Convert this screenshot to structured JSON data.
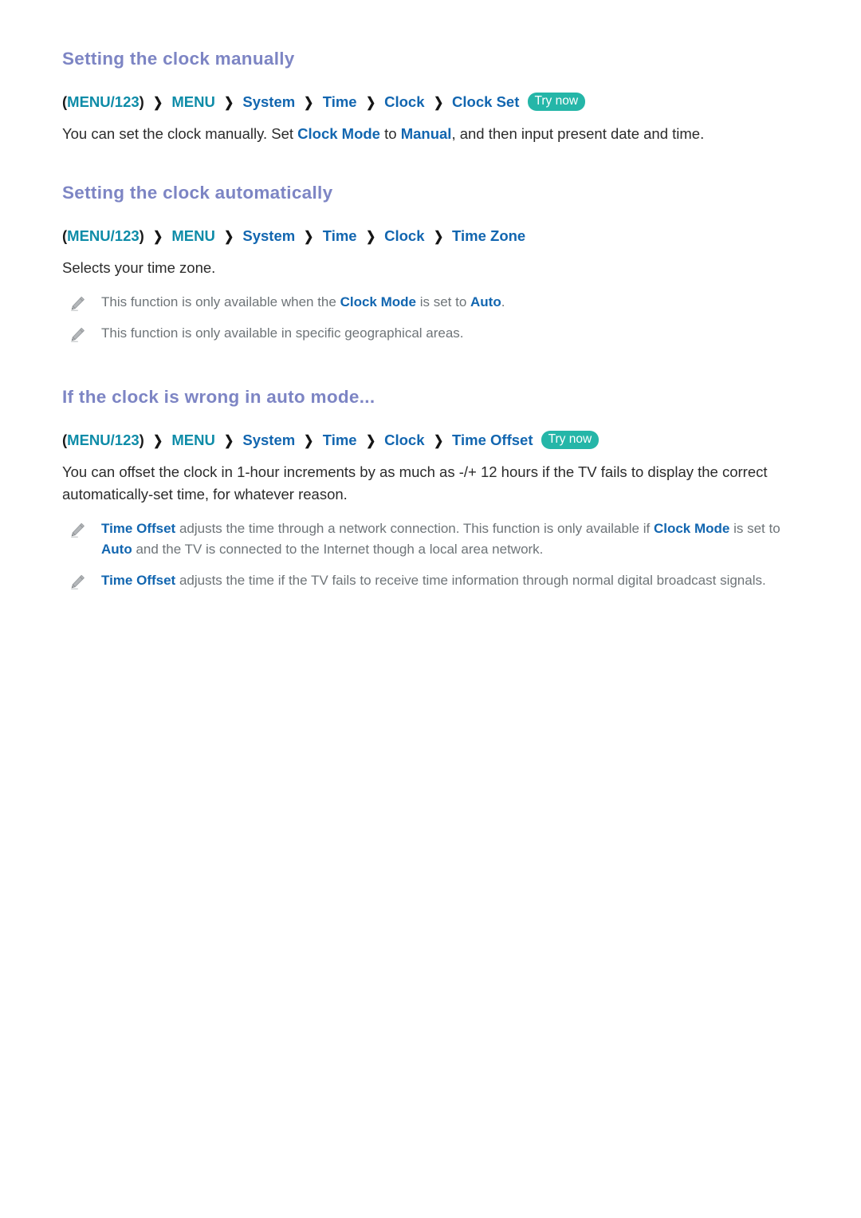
{
  "document": {
    "title": "Setting the clock manually"
  },
  "colors": {
    "heading": "#7d85c4",
    "menu_teal": "#0e8ca8",
    "menu_blue": "#1266b0",
    "try_now_badge": "#25b6a8",
    "body_text": "#2b2b2b",
    "note_text": "#6e7478",
    "background": "#ffffff"
  },
  "chevron": "❯",
  "sections": [
    {
      "heading": "Setting the clock manually",
      "path": {
        "open_paren": "(",
        "menu123": "MENU/123",
        "close_paren": ")",
        "items": [
          "MENU",
          "System",
          "Time",
          "Clock",
          "Clock Set"
        ],
        "badge": "Try now"
      },
      "body": {
        "p1": "You can set the clock manually. Set ",
        "hl1": "Clock Mode",
        "p2": " to ",
        "hl2": "Manual",
        "p3": ", and then input present date and time."
      },
      "notes": []
    },
    {
      "heading": "Setting the clock automatically",
      "path": {
        "open_paren": "(",
        "menu123": "MENU/123",
        "close_paren": ")",
        "items": [
          "MENU",
          "System",
          "Time",
          "Clock",
          "Time Zone"
        ],
        "badge": null
      },
      "body": {
        "p1": "Selects your time zone."
      },
      "notes": [
        {
          "p1": "This function is only available when the ",
          "hl1": "Clock Mode",
          "p2": " is set to ",
          "hl2": "Auto",
          "p3": "."
        },
        {
          "p1": "This function is only available in specific geographical areas."
        }
      ]
    },
    {
      "heading": "If the clock is wrong in auto mode...",
      "path": {
        "open_paren": "(",
        "menu123": "MENU/123",
        "close_paren": ")",
        "items": [
          "MENU",
          "System",
          "Time",
          "Clock",
          "Time Offset"
        ],
        "badge": "Try now"
      },
      "body": {
        "p1": "You can offset the clock in 1-hour increments by as much as -/+ 12 hours if the TV fails to display the correct automatically-set time, for whatever reason."
      },
      "notes": [
        {
          "hl0": "Time Offset",
          "p1": " adjusts the time through a network connection. This function is only available if ",
          "hl1": "Clock Mode",
          "p2": " is set to ",
          "hl2": "Auto",
          "p3": " and the TV is connected to the Internet though a local area network."
        },
        {
          "hl0": "Time Offset",
          "p1": " adjusts the time if the TV fails to receive time information through normal digital broadcast signals."
        }
      ]
    }
  ],
  "icons": {
    "note_bullet": "pencil-icon"
  }
}
